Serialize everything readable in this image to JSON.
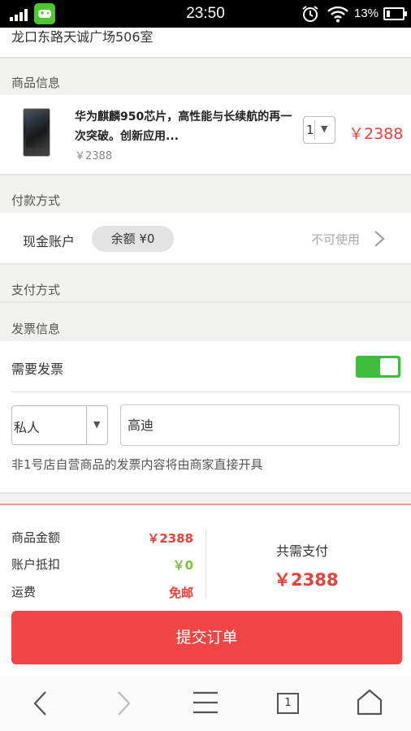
{
  "status_bar": {
    "time": "23:50",
    "battery": "13%",
    "icons": [
      "signal-icon",
      "game-app-icon",
      "alarm-icon",
      "wifi-icon",
      "battery-icon"
    ]
  },
  "address": "龙口东路天诚广场506室",
  "product_section": {
    "label": "商品信息",
    "title": "华为麒麟950芯片，高性能与长续航的再一次突破。创新应用...",
    "unit_price": "￥2388",
    "quantity": "1",
    "price": "￥2388"
  },
  "payment_section": {
    "label": "付款方式",
    "cash_label": "现金账户",
    "balance": "余额 ¥0",
    "status": "不可使用"
  },
  "pay_method_section": {
    "label": "支付方式"
  },
  "invoice_section": {
    "label": "发票信息",
    "need_invoice": "需要发票",
    "need_invoice_on": true,
    "type": "私人",
    "title_value": "高迪",
    "note": "非1号店自营商品的发票内容将由商家直接开具"
  },
  "summary": {
    "goods_label": "商品金额",
    "goods_value": "￥2388",
    "deduct_label": "账户抵扣",
    "deduct_value": "￥0",
    "shipping_label": "运费",
    "shipping_value": "免邮",
    "total_label": "共需支付",
    "total_value": "￥2388"
  },
  "submit_label": "提交订单",
  "nav": {
    "tab_count": "1"
  },
  "colors": {
    "accent_red": "#e8403a",
    "button_red": "#f04545",
    "toggle_green": "#3dbd3a",
    "deduct_green": "#7fc242"
  }
}
